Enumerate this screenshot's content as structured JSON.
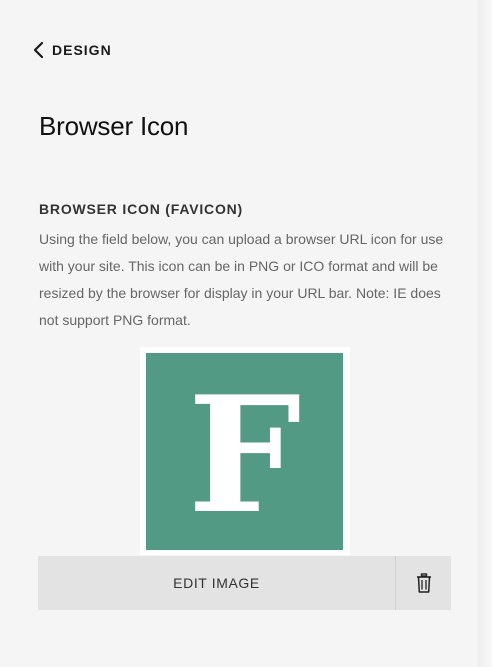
{
  "nav": {
    "back_label": "DESIGN"
  },
  "page": {
    "title": "Browser Icon"
  },
  "section": {
    "heading": "BROWSER ICON (FAVICON)",
    "description": "Using the field below, you can upload a browser URL icon for use with your site. This icon can be in PNG or ICO format and will be resized by the browser for display in your URL bar. Note: IE does not support PNG format."
  },
  "favicon": {
    "letter": "F",
    "bg_color": "#539a84",
    "letter_color": "#ffffff"
  },
  "actions": {
    "edit_label": "EDIT IMAGE",
    "delete_icon": "trash-icon"
  }
}
